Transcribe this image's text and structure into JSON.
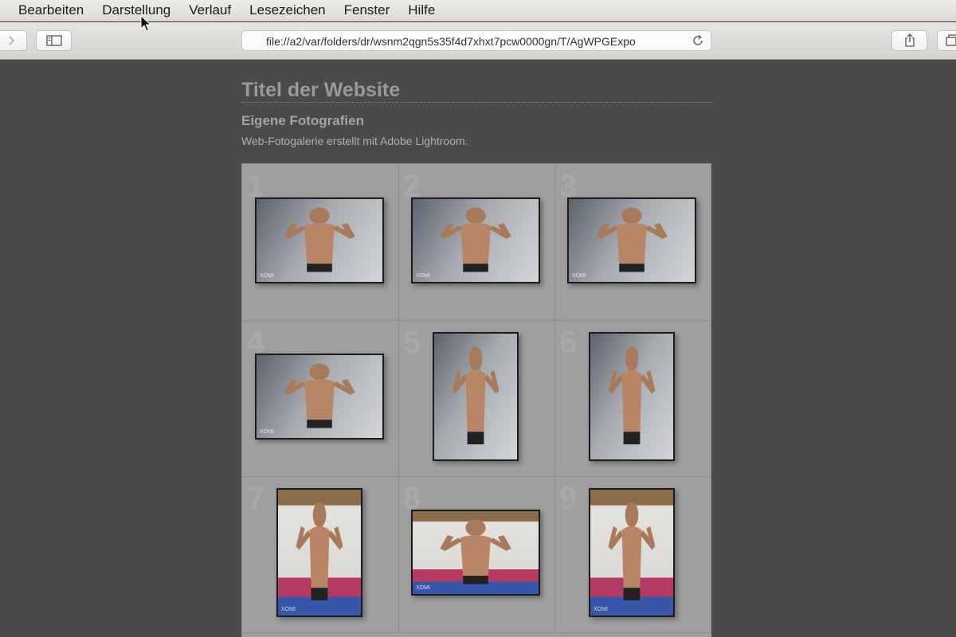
{
  "menubar": {
    "items": [
      "Bearbeiten",
      "Darstellung",
      "Verlauf",
      "Lesezeichen",
      "Fenster",
      "Hilfe"
    ]
  },
  "toolbar": {
    "url": "file://a2/var/folders/dr/wsnm2qgn5s35f4d7xhxt7pcw0000gn/T/AgWPGExpo",
    "icons": [
      "forward-icon",
      "sidebar-icon",
      "reload-icon",
      "share-icon",
      "tabs-icon"
    ]
  },
  "page": {
    "title": "Titel der Website",
    "subtitle": "Eigene Fotografien",
    "description": "Web-Fotogalerie erstellt mit Adobe Lightroom."
  },
  "gallery": {
    "cells": [
      {
        "number": "1",
        "orientation": "landscape",
        "watermark": "XOMI",
        "scene": "wall"
      },
      {
        "number": "2",
        "orientation": "landscape",
        "watermark": "XOMI",
        "scene": "wall"
      },
      {
        "number": "3",
        "orientation": "landscape",
        "watermark": "XOMI",
        "scene": "wall"
      },
      {
        "number": "4",
        "orientation": "landscape",
        "watermark": "XOMI",
        "scene": "wall"
      },
      {
        "number": "5",
        "orientation": "portrait",
        "watermark": "",
        "scene": "wall"
      },
      {
        "number": "6",
        "orientation": "portrait",
        "watermark": "",
        "scene": "wall"
      },
      {
        "number": "7",
        "orientation": "portrait",
        "watermark": "XOMI",
        "scene": "gym"
      },
      {
        "number": "8",
        "orientation": "landscape",
        "watermark": "XOMI",
        "scene": "gym"
      },
      {
        "number": "9",
        "orientation": "portrait",
        "watermark": "XOMI",
        "scene": "gym"
      }
    ]
  },
  "colors": {
    "page_background": "#4a4a4a",
    "grid_background": "#a09f9f",
    "title_text": "#9a9a9a"
  }
}
